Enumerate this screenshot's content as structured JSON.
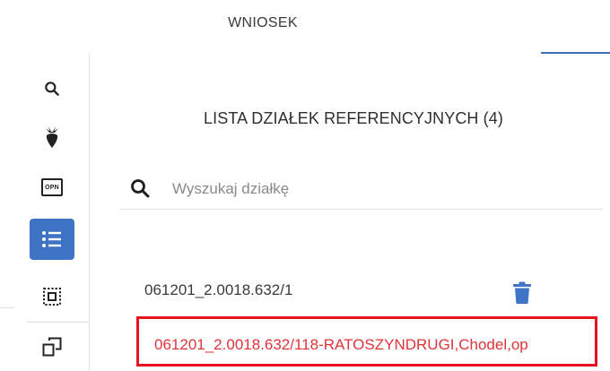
{
  "header": {
    "tab_label": "WNIOSEK"
  },
  "rail": {
    "items": [
      {
        "icon": "search-icon",
        "active": false
      },
      {
        "icon": "beet-icon",
        "active": false
      },
      {
        "icon": "opn-icon",
        "label": "OPN",
        "active": false
      },
      {
        "icon": "list-icon",
        "active": true
      },
      {
        "icon": "select-area-icon",
        "active": false
      },
      {
        "icon": "copy-windows-icon",
        "active": false
      }
    ]
  },
  "main": {
    "title": "LISTA DZIAŁEK REFERENCYJNYCH (4)",
    "search": {
      "placeholder": "Wyszukaj działkę",
      "value": ""
    },
    "parcels": [
      {
        "id": "061201_2.0018.632/1"
      },
      {
        "id": "061201_2.0018.632/118-RATOSZYNDRUGI,Chodel,op"
      }
    ]
  },
  "colors": {
    "accent": "#3f74c5",
    "highlight": "#e8121a",
    "error_text": "#e0343a"
  }
}
